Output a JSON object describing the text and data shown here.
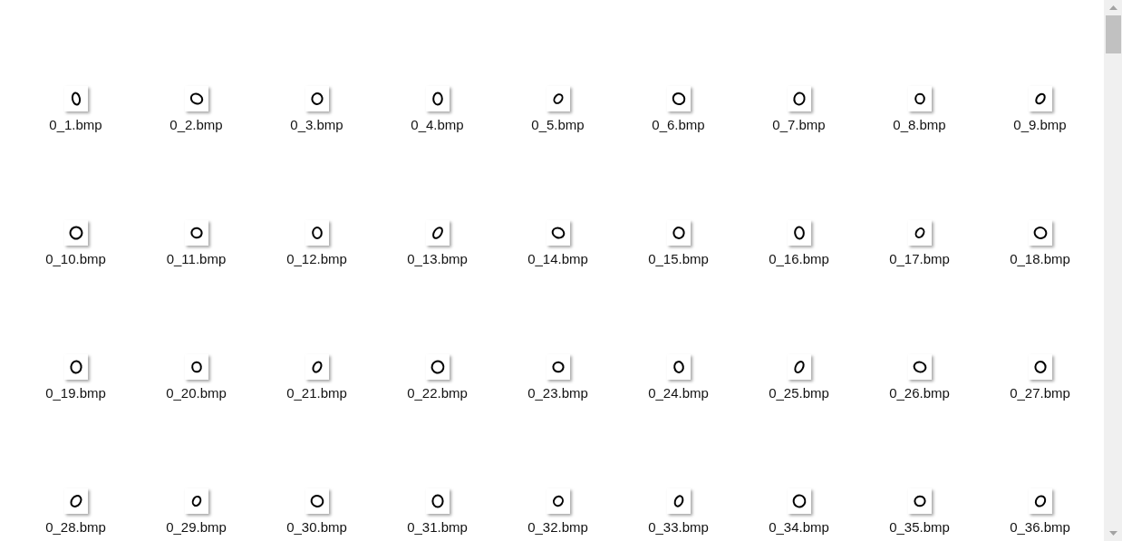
{
  "files": [
    {
      "name": "0_1.bmp"
    },
    {
      "name": "0_2.bmp"
    },
    {
      "name": "0_3.bmp"
    },
    {
      "name": "0_4.bmp"
    },
    {
      "name": "0_5.bmp"
    },
    {
      "name": "0_6.bmp"
    },
    {
      "name": "0_7.bmp"
    },
    {
      "name": "0_8.bmp"
    },
    {
      "name": "0_9.bmp"
    },
    {
      "name": "0_10.bmp"
    },
    {
      "name": "0_11.bmp"
    },
    {
      "name": "0_12.bmp"
    },
    {
      "name": "0_13.bmp"
    },
    {
      "name": "0_14.bmp"
    },
    {
      "name": "0_15.bmp"
    },
    {
      "name": "0_16.bmp"
    },
    {
      "name": "0_17.bmp"
    },
    {
      "name": "0_18.bmp"
    },
    {
      "name": "0_19.bmp"
    },
    {
      "name": "0_20.bmp"
    },
    {
      "name": "0_21.bmp"
    },
    {
      "name": "0_22.bmp"
    },
    {
      "name": "0_23.bmp"
    },
    {
      "name": "0_24.bmp"
    },
    {
      "name": "0_25.bmp"
    },
    {
      "name": "0_26.bmp"
    },
    {
      "name": "0_27.bmp"
    },
    {
      "name": "0_28.bmp"
    },
    {
      "name": "0_29.bmp"
    },
    {
      "name": "0_30.bmp"
    },
    {
      "name": "0_31.bmp"
    },
    {
      "name": "0_32.bmp"
    },
    {
      "name": "0_33.bmp"
    },
    {
      "name": "0_34.bmp"
    },
    {
      "name": "0_35.bmp"
    },
    {
      "name": "0_36.bmp"
    }
  ]
}
